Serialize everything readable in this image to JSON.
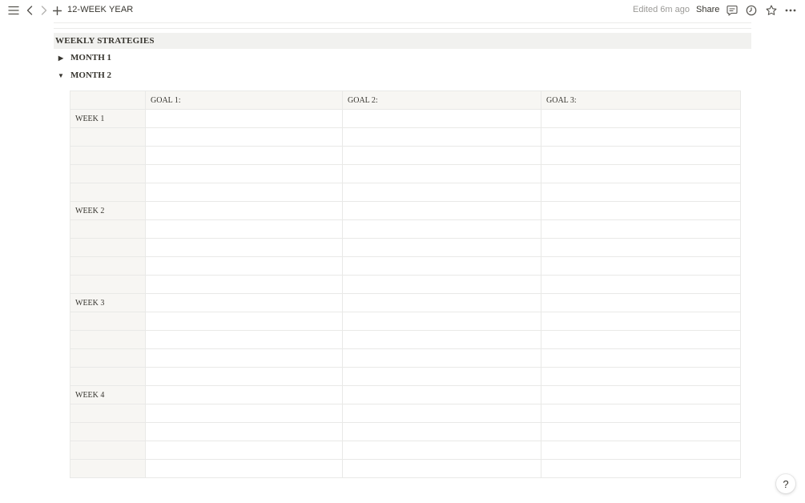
{
  "topbar": {
    "title": "12-WEEK YEAR",
    "edited": "Edited 6m ago",
    "share_label": "Share",
    "icons": [
      "menu-icon",
      "back-arrow-icon",
      "forward-arrow-icon",
      "plus-icon",
      "comment-icon",
      "clock-icon",
      "star-icon",
      "more-icon"
    ]
  },
  "section": {
    "heading": "WEEKLY STRATEGIES",
    "toggles": [
      {
        "label": "MONTH 1",
        "expanded": false
      },
      {
        "label": "MONTH 2",
        "expanded": true
      }
    ]
  },
  "table": {
    "headers": [
      "",
      "GOAL 1:",
      "GOAL 2:",
      "GOAL 3:"
    ],
    "weeks": [
      "WEEK 1",
      "WEEK 2",
      "WEEK 3",
      "WEEK 4"
    ],
    "rows_per_week": 5
  },
  "help_label": "?"
}
